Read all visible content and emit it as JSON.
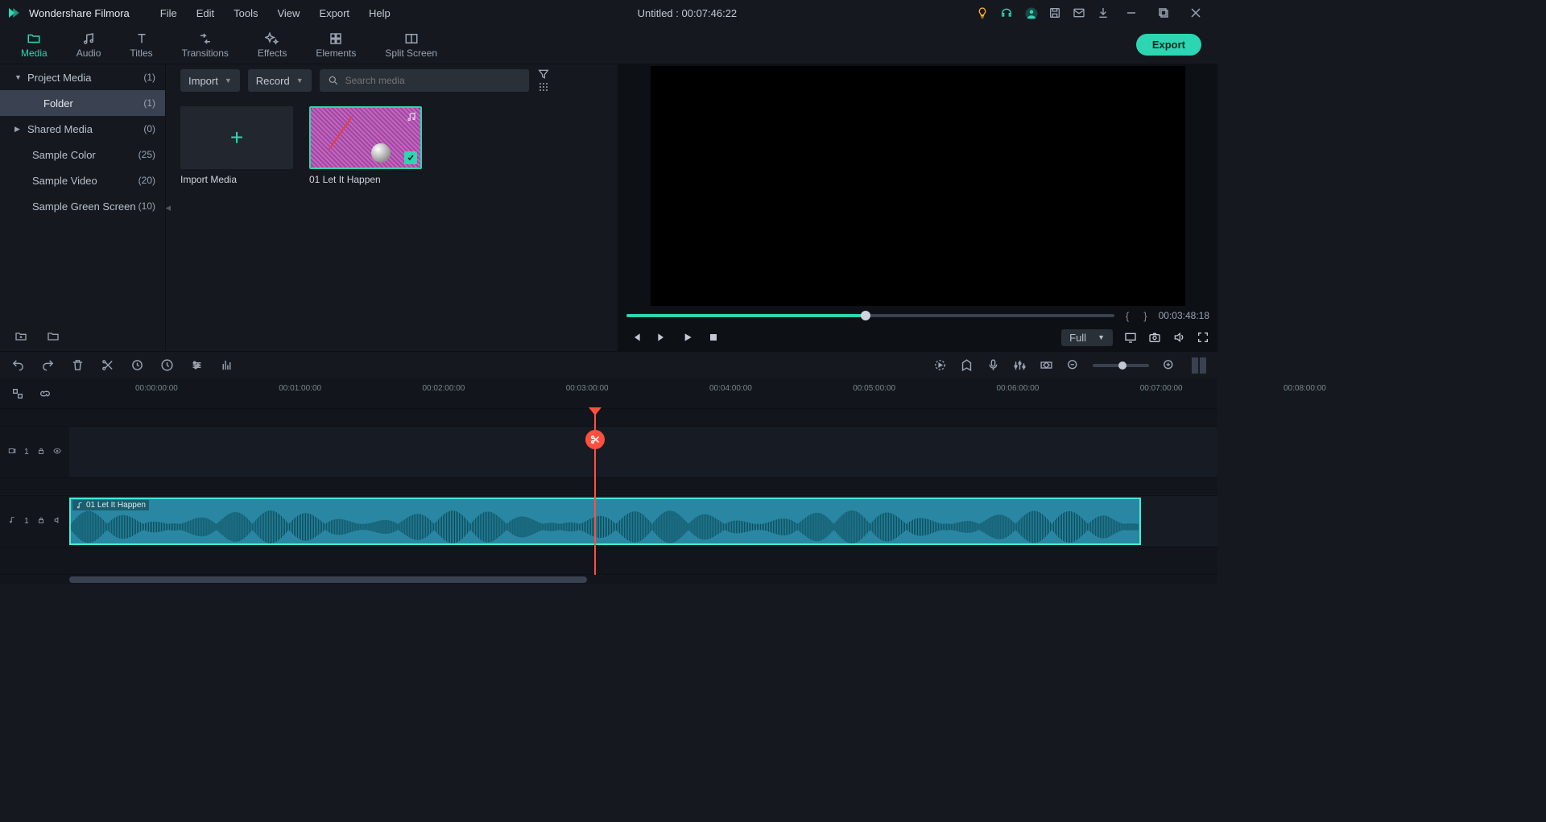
{
  "titlebar": {
    "app_name": "Wondershare Filmora",
    "menus": [
      "File",
      "Edit",
      "Tools",
      "View",
      "Export",
      "Help"
    ],
    "center": "Untitled : 00:07:46:22"
  },
  "top_tabs": {
    "items": [
      "Media",
      "Audio",
      "Titles",
      "Transitions",
      "Effects",
      "Elements",
      "Split Screen"
    ],
    "active": 0,
    "export_label": "Export"
  },
  "sidebar": {
    "items": [
      {
        "label": "Project Media",
        "count": "(1)",
        "expanded": true,
        "level": 0
      },
      {
        "label": "Folder",
        "count": "(1)",
        "level": 1,
        "selected": true
      },
      {
        "label": "Shared Media",
        "count": "(0)",
        "level": 0,
        "expanded": false
      },
      {
        "label": "Sample Color",
        "count": "(25)",
        "level": 1
      },
      {
        "label": "Sample Video",
        "count": "(20)",
        "level": 1
      },
      {
        "label": "Sample Green Screen",
        "count": "(10)",
        "level": 1
      }
    ]
  },
  "media_toolbar": {
    "import_label": "Import",
    "record_label": "Record",
    "search_placeholder": "Search media"
  },
  "media_items": {
    "add_label": "Import Media",
    "clip1_label": "01 Let It Happen"
  },
  "preview": {
    "timecode": "00:03:48:18",
    "quality": "Full"
  },
  "ruler": {
    "marks": [
      "00:00:00:00",
      "00:01:00:00",
      "00:02:00:00",
      "00:03:00:00",
      "00:04:00:00",
      "00:05:00:00",
      "00:06:00:00",
      "00:07:00:00",
      "00:08:00:00"
    ]
  },
  "timeline": {
    "track_video": "1",
    "track_audio": "1",
    "clip_label": "01 Let It Happen"
  }
}
